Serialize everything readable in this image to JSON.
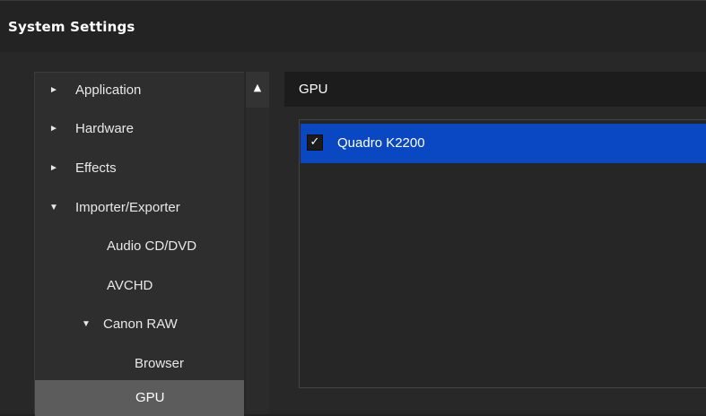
{
  "window": {
    "title": "System Settings"
  },
  "tree": {
    "items": [
      {
        "label": "Application",
        "arrow": "►",
        "expanded": false
      },
      {
        "label": "Hardware",
        "arrow": "►",
        "expanded": false
      },
      {
        "label": "Effects",
        "arrow": "►",
        "expanded": false
      },
      {
        "label": "Importer/Exporter",
        "arrow": "▼",
        "expanded": true
      },
      {
        "label": "Audio CD/DVD"
      },
      {
        "label": "AVCHD"
      },
      {
        "label": "Canon RAW",
        "arrow": "▼",
        "expanded": true
      },
      {
        "label": "Browser"
      },
      {
        "label": "GPU",
        "selected": true
      }
    ],
    "scroll_up_glyph": "▲"
  },
  "pane": {
    "header": "GPU",
    "gpu_list": [
      {
        "label": "Quadro K2200",
        "checked": true,
        "check_glyph": "✓"
      }
    ]
  },
  "colors": {
    "selection_blue": "#0a47c2",
    "tree_selected": "#5c5c5c",
    "background": "#222222"
  }
}
